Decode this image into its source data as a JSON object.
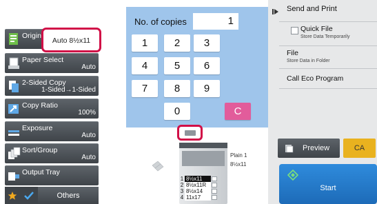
{
  "left_panel": {
    "functions": [
      {
        "key": "original",
        "label": "Original",
        "value": "Auto 8½x11",
        "icon": "original-page-icon"
      },
      {
        "key": "paper_select",
        "label": "Paper Select",
        "value": "Auto",
        "icon": "paper-tray-icon"
      },
      {
        "key": "two_sided_copy",
        "label": "2-Sided Copy",
        "value": "1-Sided→1-Sided",
        "icon": "two-sided-copy-icon"
      },
      {
        "key": "copy_ratio",
        "label": "Copy Ratio",
        "value": "100%",
        "icon": "copy-ratio-icon"
      },
      {
        "key": "exposure",
        "label": "Exposure",
        "value": "Auto",
        "icon": "exposure-icon"
      },
      {
        "key": "sort_group",
        "label": "Sort/Group",
        "value": "Auto",
        "icon": "sort-group-icon"
      },
      {
        "key": "output_tray",
        "label": "Output Tray",
        "value": "",
        "icon": "output-tray-icon"
      }
    ],
    "bottom": {
      "favorite_icon": "star-icon",
      "check_icon": "checkmark-icon",
      "others_label": "Others"
    }
  },
  "copies": {
    "label": "No. of copies",
    "value": "1",
    "keys": [
      "1",
      "2",
      "3",
      "4",
      "5",
      "6",
      "7",
      "8",
      "9",
      "0"
    ],
    "clear_label": "C"
  },
  "machine": {
    "trays": [
      {
        "num": "1",
        "size": "8½x11",
        "selected": true
      },
      {
        "num": "2",
        "size": "8½x11R",
        "selected": false
      },
      {
        "num": "3",
        "size": "8½x14",
        "selected": false
      },
      {
        "num": "4",
        "size": "11x17",
        "selected": false
      }
    ],
    "bypass_label": "Plain 1",
    "bypass_size": "8½x11"
  },
  "right_panel": {
    "expand_icon": "play-arrow-icon",
    "items": [
      {
        "key": "send_and_print",
        "label": "Send and Print",
        "sub": ""
      },
      {
        "key": "quick_file",
        "label": "Quick File",
        "sub": "Store Data Temporarily"
      },
      {
        "key": "file",
        "label": "File",
        "sub": "Store Data in Folder"
      },
      {
        "key": "call_eco_program",
        "label": "Call Eco Program",
        "sub": ""
      }
    ],
    "preview_label": "Preview",
    "ca_label": "CA",
    "start_label": "Start"
  },
  "colors": {
    "keypad_bg": "#9fc5eb",
    "highlight": "#d10f47",
    "clear_key": "#e25c9b",
    "ca_button": "#e9b21f",
    "start_button": "#1d6bb8",
    "function_button": "#4a5055"
  }
}
